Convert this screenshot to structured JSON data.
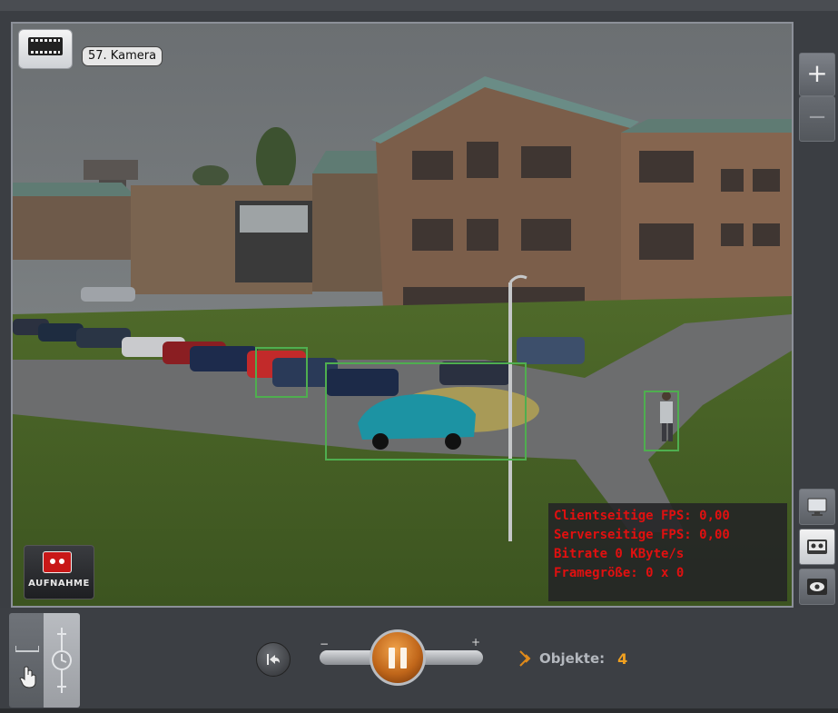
{
  "camera": {
    "label": "57. Kamera"
  },
  "stats": {
    "client_fps": "Clientseitige FPS: 0,00",
    "server_fps": "Serverseitige FPS: 0,00",
    "bitrate": "Bitrate 0 KByte/s",
    "frame_size": "Framegröße: 0 x 0"
  },
  "record_button": {
    "label": "AUFNAHME"
  },
  "zoom": {
    "plus": "+",
    "minus": "−"
  },
  "playback": {
    "minus": "−",
    "plus": "+"
  },
  "objects": {
    "label": "Objekte:",
    "count": "4"
  },
  "colors": {
    "stats_text": "#e11010",
    "accent": "#f0a020",
    "detection_box": "#4fae4f"
  },
  "icons": [
    "film-icon",
    "record-icon",
    "zoom-in-icon",
    "zoom-out-icon",
    "monitor-icon",
    "tape-icon",
    "eye-icon",
    "timeline-icon",
    "hand-icon",
    "clock-icon",
    "back-icon",
    "pause-icon",
    "objects-icon"
  ]
}
